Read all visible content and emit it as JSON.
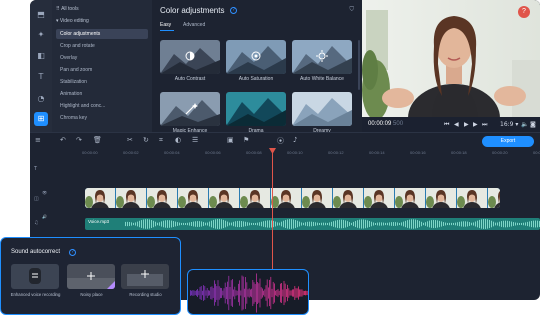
{
  "tools_panel": {
    "header": "All tools",
    "section": "Video editing",
    "items": [
      {
        "label": "Color adjustments",
        "active": true
      },
      {
        "label": "Crop and rotate"
      },
      {
        "label": "Overlay"
      },
      {
        "label": "Pan and zoom"
      },
      {
        "label": "Stabilization"
      },
      {
        "label": "Animation"
      },
      {
        "label": "Highlight and conc..."
      },
      {
        "label": "Chroma key"
      }
    ]
  },
  "color_panel": {
    "title": "Color adjustments",
    "tabs": [
      "Easy",
      "Advanced"
    ],
    "effects": [
      {
        "label": "Auto Contrast",
        "icon": "contrast-icon"
      },
      {
        "label": "Auto Saturation",
        "icon": "saturation-icon"
      },
      {
        "label": "Auto White Balance",
        "icon": "white-balance-icon"
      },
      {
        "label": "Magic Enhance",
        "icon": "magic-wand-icon"
      },
      {
        "label": "Drama",
        "icon": ""
      },
      {
        "label": "Dreamy",
        "icon": ""
      }
    ]
  },
  "player": {
    "time_current": "00:00:09",
    "time_total": "500",
    "aspect": "16:9",
    "progress": 0.04
  },
  "ruler": {
    "ticks": [
      "00:00:00",
      "00:00:02",
      "00:00:04",
      "00:00:06",
      "00:00:08",
      "00:00:10",
      "00:00:12",
      "00:00:14",
      "00:00:16",
      "00:00:18",
      "00:00:20",
      "00:00:22"
    ]
  },
  "toolbar": {
    "export_label": "Export"
  },
  "timeline": {
    "audio_clip_label": "Voice.mp3"
  },
  "sound_autocorrect": {
    "title": "Sound autocorrect",
    "options": [
      {
        "label": "Enhanced voice recording"
      },
      {
        "label": "Noisy place"
      },
      {
        "label": "Recording studio"
      }
    ]
  },
  "colors": {
    "accent": "#1f8fff",
    "playhead": "#e0554a",
    "audio": "#1f7f78",
    "video_clip": "#3fa0d8"
  }
}
